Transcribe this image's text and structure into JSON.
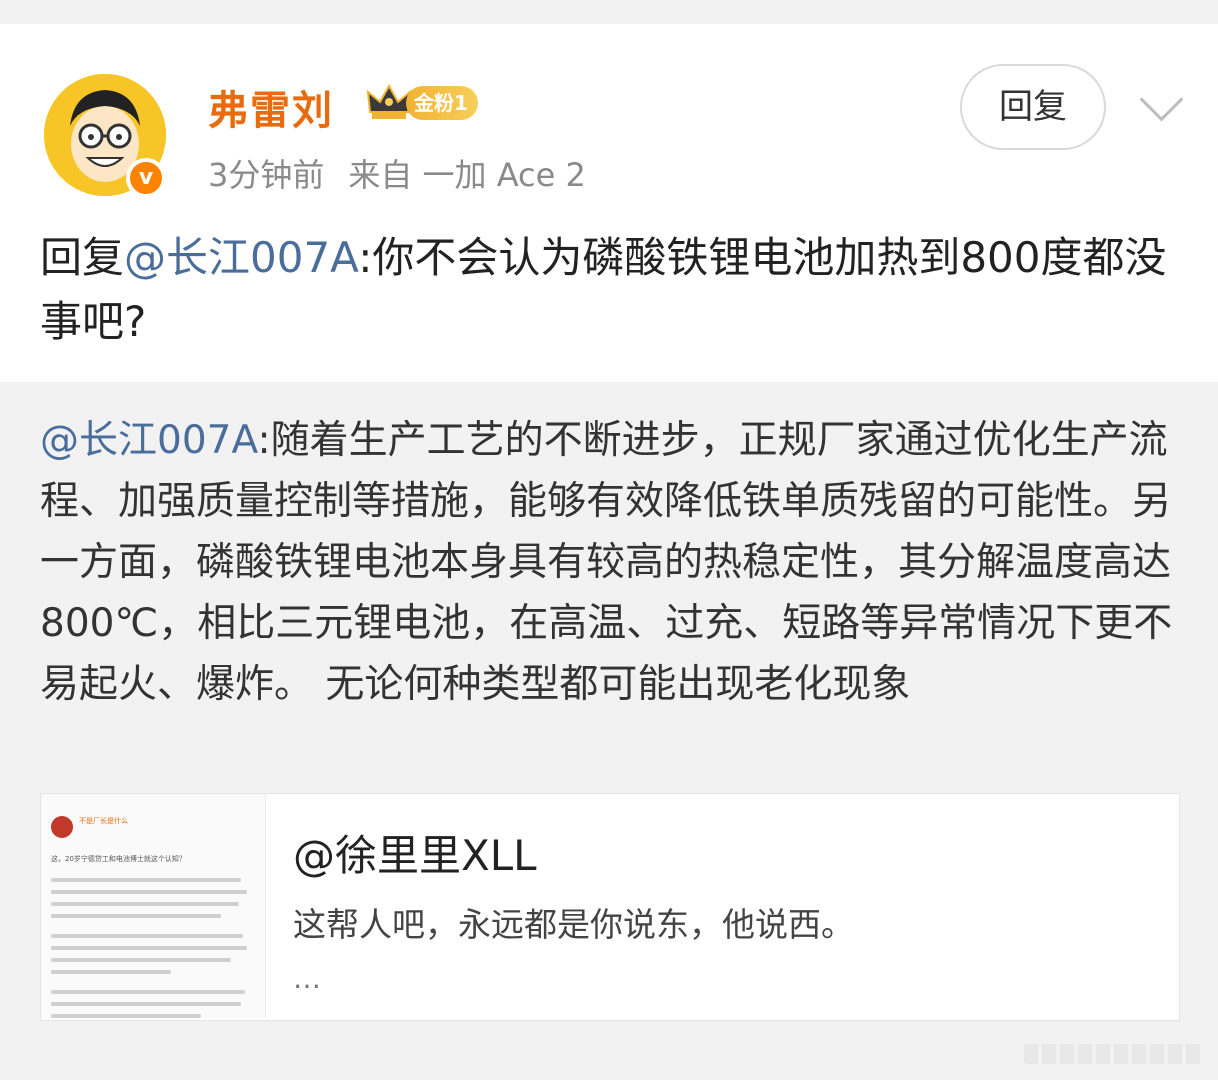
{
  "post": {
    "username": "弗雷刘",
    "fan_badge": "金粉1",
    "verified_mark": "v",
    "time": "3分钟前",
    "source": "来自 一加 Ace 2",
    "reply_button": "回复",
    "reply_prefix": "回复",
    "reply_mention": "@长江007A",
    "reply_text": ":你不会认为磷酸铁锂电池加热到800度都没事吧?"
  },
  "quoted": {
    "mention": "@长江007A",
    "text": ":随着生产工艺的不断进步，正规厂家通过优化生产流程、加强质量控制等措施，能够有效降低铁单质残留的可能性。另一方面，磷酸铁锂电池本身具有较高的热稳定性，其分解温度高达800℃，相比三元锂电池，在高温、过充、短路等异常情况下更不易起火、爆炸。 无论何种类型都可能出现老化现象"
  },
  "link_card": {
    "title": "@徐里里XLL",
    "description": "这帮人吧，永远都是你说东，他说西。",
    "ellipsis": "…",
    "thumbnail_name": "不是厂长是什么",
    "thumbnail_question": "这，20岁宁德贷工和电池博士就这个认知？"
  },
  "colors": {
    "username": "#e86b0e",
    "mention": "#4a6d9c",
    "avatar_bg": "#f7c626",
    "verify_badge": "#ff8200"
  },
  "icons": [
    "crown-icon",
    "verified-v-icon",
    "chevron-down-icon"
  ]
}
